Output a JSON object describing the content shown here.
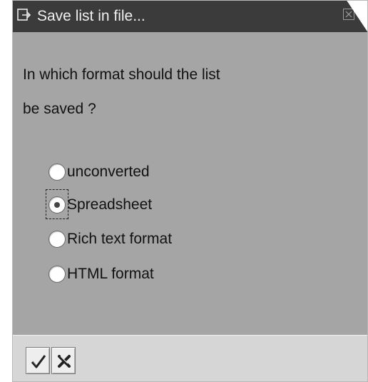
{
  "dialog": {
    "title": "Save list in file...",
    "question_line1": "In which format should the list",
    "question_line2": "be saved ?"
  },
  "options": [
    {
      "label": "unconverted",
      "selected": false
    },
    {
      "label": "Spreadsheet",
      "selected": true
    },
    {
      "label": "Rich text format",
      "selected": false
    },
    {
      "label": "HTML format",
      "selected": false
    }
  ],
  "footer": {
    "confirm_icon": "checkmark-icon",
    "cancel_icon": "cancel-x-icon"
  },
  "colors": {
    "titlebar": "#3b3b3b",
    "body": "#a5a5a5",
    "footer": "#d6d6d6"
  }
}
